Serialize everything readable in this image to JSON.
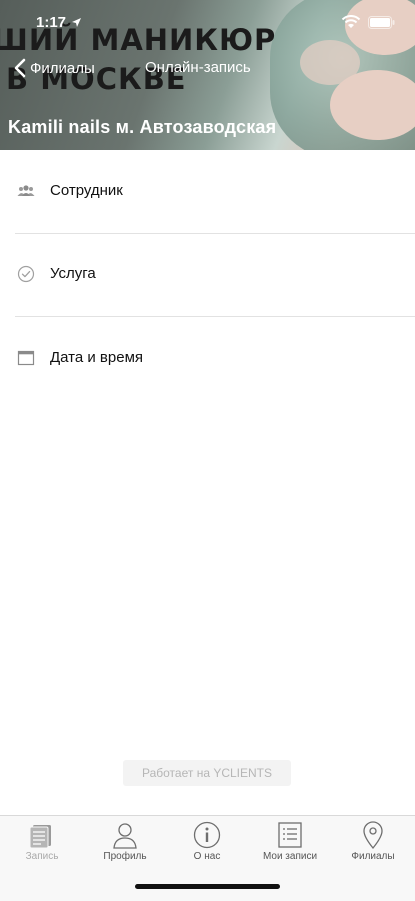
{
  "status_bar": {
    "time": "1:17"
  },
  "header": {
    "promo_line1": "ШИЙ МАНИКЮР",
    "promo_line2": "В МОСКВЕ",
    "back_label": "Филиалы",
    "title": "Онлайн-запись",
    "branch_name": "Kamili nails м. Автозаводская"
  },
  "list": {
    "items": [
      {
        "label": "Сотрудник",
        "icon": "people-icon"
      },
      {
        "label": "Услуга",
        "icon": "check-circle-icon"
      },
      {
        "label": "Дата и время",
        "icon": "calendar-icon"
      }
    ]
  },
  "footer": {
    "powered_by": "Работает на YCLIENTS"
  },
  "tabbar": {
    "tabs": [
      {
        "label": "Запись",
        "icon": "booking-list-icon",
        "active": true
      },
      {
        "label": "Профиль",
        "icon": "profile-icon",
        "active": false
      },
      {
        "label": "О нас",
        "icon": "info-icon",
        "active": false
      },
      {
        "label": "Мои записи",
        "icon": "my-records-icon",
        "active": false
      },
      {
        "label": "Филиалы",
        "icon": "location-pin-icon",
        "active": false
      }
    ]
  },
  "colors": {
    "accent": "#ffffff",
    "separator": "#e2e2e2",
    "tab_active_label": "#a9a9a9"
  }
}
